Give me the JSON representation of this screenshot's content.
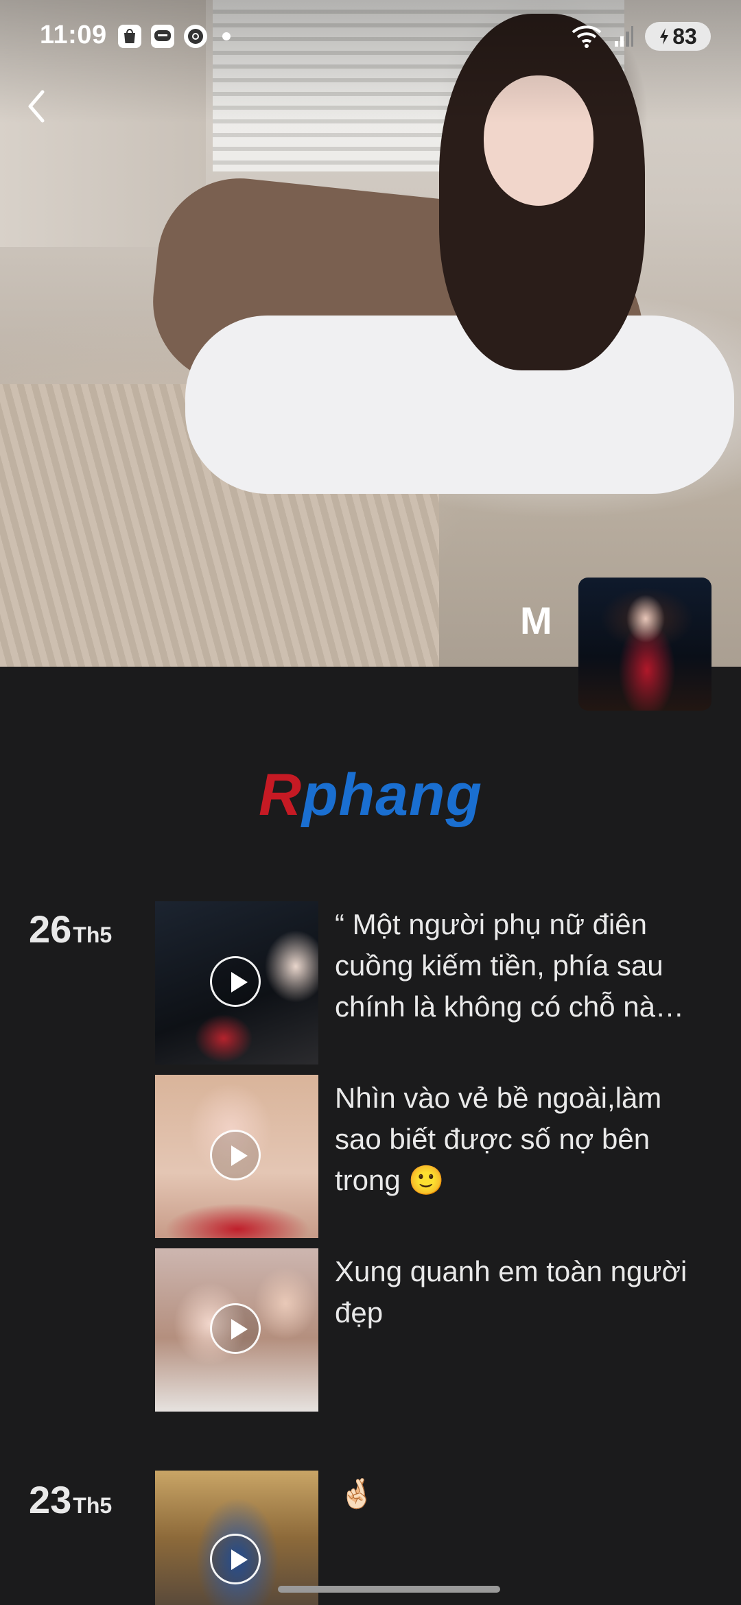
{
  "status_bar": {
    "time": "11:09",
    "left_icons": [
      "shopee-icon",
      "zalo-icon",
      "chrome-icon"
    ],
    "battery": "83"
  },
  "profile": {
    "initial": "M"
  },
  "watermark": {
    "logo_first": "R",
    "logo_rest": "phang"
  },
  "timeline": [
    {
      "day": "26",
      "month": "Th5",
      "posts": [
        {
          "caption": "“ Một người phụ nữ điên cuồng kiếm tiền, phía sau chính là không có chỗ nà…",
          "type": "video"
        },
        {
          "caption": "Nhìn vào vẻ bề ngoài,làm sao biết được số nợ bên trong 🙂",
          "type": "video"
        },
        {
          "caption": "Xung quanh em toàn người đẹp",
          "type": "video"
        }
      ]
    },
    {
      "day": "23",
      "month": "Th5",
      "posts": [
        {
          "caption": "🤞🏻",
          "type": "video"
        }
      ]
    }
  ],
  "colors": {
    "background": "#1b1b1c",
    "text": "#e9e9e9",
    "logo_red": "#c61a24",
    "logo_blue": "#1a6fd1"
  }
}
